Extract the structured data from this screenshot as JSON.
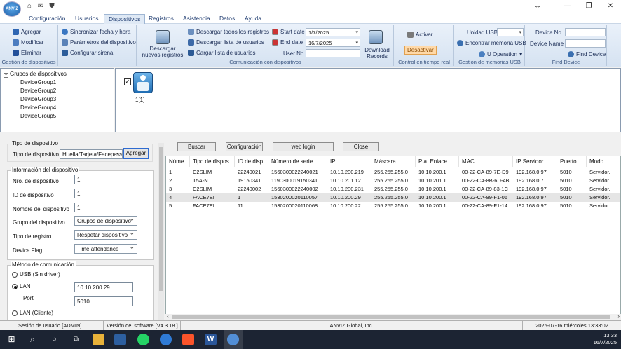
{
  "app": {
    "logo_text": "ANVIZ"
  },
  "title_bar": {
    "min": "↔",
    "restore": "❐",
    "close": "✕"
  },
  "menu_tabs": [
    "Configuración",
    "Usuarios",
    "Dispositivos",
    "Registros",
    "Asistencia",
    "Datos",
    "Ayuda"
  ],
  "ribbon": {
    "gestion": {
      "title": "Gestión de dispositivos",
      "add": "Agregar",
      "modify": "Modificar",
      "delete": "Eliminar"
    },
    "sync": {
      "sync_time": "Sincronizar fecha y hora",
      "params": "Parámetros del dispositivo",
      "siren": "Configurar sirena"
    },
    "comm": {
      "title": "Comunicación con dispositivos",
      "download_new": "Descargar nuevos registros",
      "download_all": "Descargar todos los registros",
      "download_users": "Descargar lista de usuarios",
      "upload_users": "Cargar lista de usuarios",
      "start_label": "Start date",
      "start_value": "1/7/2025",
      "end_label": "End date",
      "end_value": "16/7/2025",
      "user_no_label": "User No.",
      "download_records": "Download Records"
    },
    "realtime": {
      "title": "Control en tiempo real",
      "activate": "Activar",
      "deactivate": "Desactivar"
    },
    "usb": {
      "title": "Gestión de memorias USB",
      "usb_unit": "Unidad USB",
      "find_usb": "Encontrar memoria USB",
      "u_operation": "U Operation"
    },
    "find": {
      "title": "Find Device",
      "device_no": "Device No.",
      "device_name": "Device Name",
      "find_device": "Find Device"
    }
  },
  "tree": {
    "root": "Grupos de dispositivos",
    "items": [
      "DeviceGroup1",
      "DeviceGroup2",
      "DeviceGroup3",
      "DeviceGroup4",
      "DeviceGroup5"
    ]
  },
  "device_tile": {
    "label": "1[1]"
  },
  "form": {
    "device_type_legend": "Tipo de dispositivo",
    "device_type_label": "Tipo de dispositivo",
    "device_type_value": "Huella/Tarjeta/Facepass",
    "add_button": "Agregar",
    "info_legend": "Información del dispositivo",
    "nro_label": "Nro. de dispositivo",
    "nro_value": "1",
    "id_label": "ID de dispositivo",
    "id_value": "1",
    "name_label": "Nombre del dispositivo",
    "name_value": "1",
    "group_label": "Grupo del dispositivo",
    "group_value": "Grupos de dispositivo",
    "reg_type_label": "Tipo de registro",
    "reg_type_value": "Respetar dispositivo",
    "flag_label": "Device Flag",
    "flag_value": "Time attendance",
    "comm_legend": "Método de comunicación",
    "usb_option": "USB (Sin driver)",
    "lan_option": "LAN",
    "lan_ip": "10.10.200.29",
    "port_label": "Port",
    "port_value": "5010",
    "lan_client_option": "LAN (Cliente)"
  },
  "table_buttons": {
    "search": "Buscar",
    "config": "Configuración",
    "web_login": "web login",
    "close": "Close"
  },
  "table": {
    "headers": [
      "Núme...",
      "Tipo de dispos...",
      "ID de disp...",
      "Número de serie",
      "IP",
      "Máscara",
      "Pta. Enlace",
      "MAC",
      "IP Servidor",
      "Puerto",
      "Modo"
    ],
    "rows": [
      [
        "1",
        "C2SLIM",
        "22240021",
        "1560300022240021",
        "10.10.200.219",
        "255.255.255.0",
        "10.10.200.1",
        "00-22-CA-89-7E-D9",
        "192.168.0.97",
        "5010",
        "Servidor."
      ],
      [
        "2",
        "T5A-N",
        "19150341",
        "1190300019150341",
        "10.10.201.12",
        "255.255.255.0",
        "10.10.201.1",
        "00-22-CA-8B-6D-4B",
        "192.168.0.7",
        "5010",
        "Servidor."
      ],
      [
        "3",
        "C2SLIM",
        "22240002",
        "1560300022240002",
        "10.10.200.231",
        "255.255.255.0",
        "10.10.200.1",
        "00-22-CA-89-83-1C",
        "192.168.0.97",
        "5010",
        "Servidor."
      ],
      [
        "4",
        "FACE7EI",
        "1",
        "1530200020110057",
        "10.10.200.29",
        "255.255.255.0",
        "10.10.200.1",
        "00-22-CA-89-F1-06",
        "192.168.0.97",
        "5010",
        "Servidor."
      ],
      [
        "5",
        "FACE7EI",
        "11",
        "1530200020110068",
        "10.10.200.22",
        "255.255.255.0",
        "10.10.200.1",
        "00-22-CA-89-F1-14",
        "192.168.0.97",
        "5010",
        "Servidor."
      ]
    ]
  },
  "status_bar": {
    "session": "Sesión de usuario  [ADMIN]",
    "version": "Versión del software  [V4.3.18.]",
    "company": "ANVIZ Global, Inc.",
    "datetime": "2025-07-16 miércoles 13:33:02"
  },
  "taskbar": {
    "time": "13:33",
    "date": "16/7/2025"
  }
}
